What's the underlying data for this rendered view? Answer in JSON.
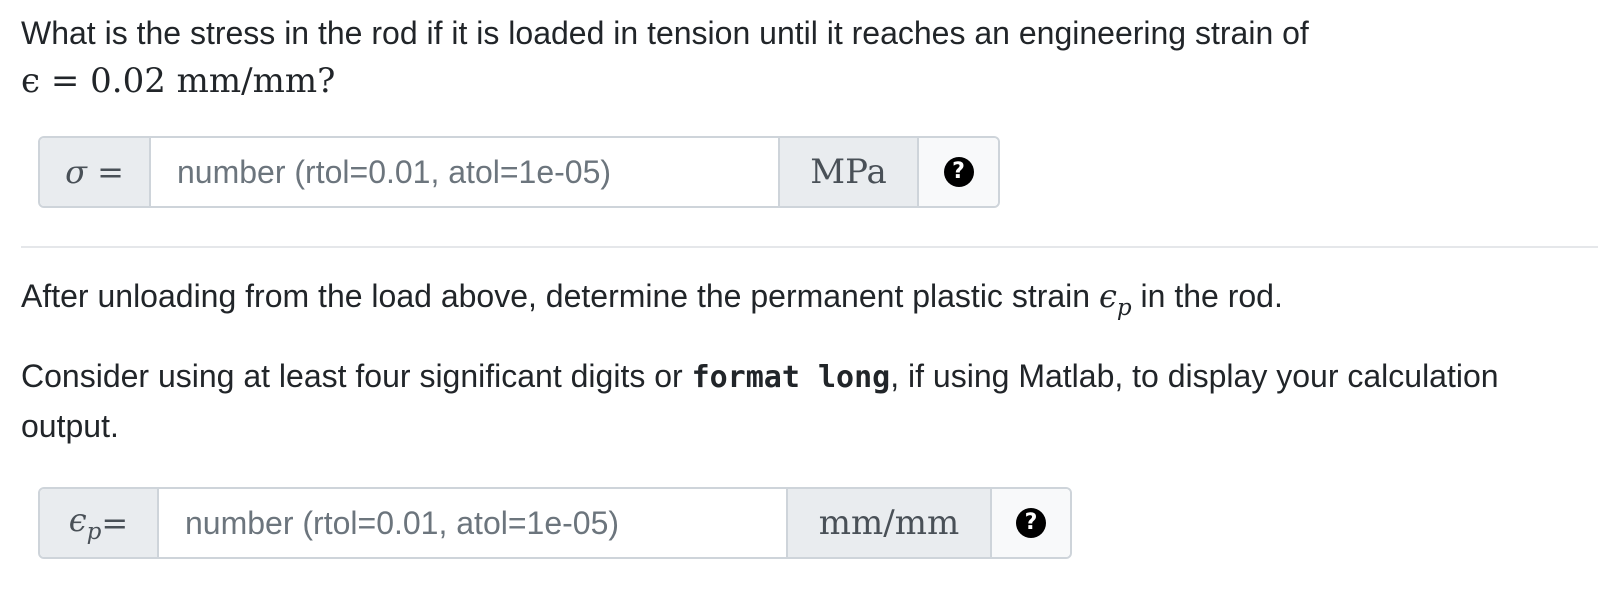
{
  "question1": {
    "text": "What is the stress in the rod if it is loaded in tension until it reaches an engineering strain of",
    "strain_expr": "ϵ = 0.02 mm/mm?"
  },
  "answer1": {
    "label": "σ =",
    "placeholder": "number (rtol=0.01, atol=1e-05)",
    "unit": "MPa",
    "help_icon": "question-circle-icon",
    "help_glyph": "?"
  },
  "question2": {
    "text_before": "After unloading from the load above, determine the permanent plastic strain ",
    "symbol": "ϵ",
    "symbol_sub": "p",
    "text_after": " in the rod."
  },
  "hint": {
    "text_before": "Consider using at least four significant digits or ",
    "code": "format long",
    "text_after": ", if using Matlab, to display your calculation output."
  },
  "answer2": {
    "label_symbol": "ϵ",
    "label_sub": "p",
    "label_eq": " =",
    "placeholder": "number (rtol=0.01, atol=1e-05)",
    "unit": "mm/mm",
    "help_icon": "question-circle-icon",
    "help_glyph": "?"
  }
}
